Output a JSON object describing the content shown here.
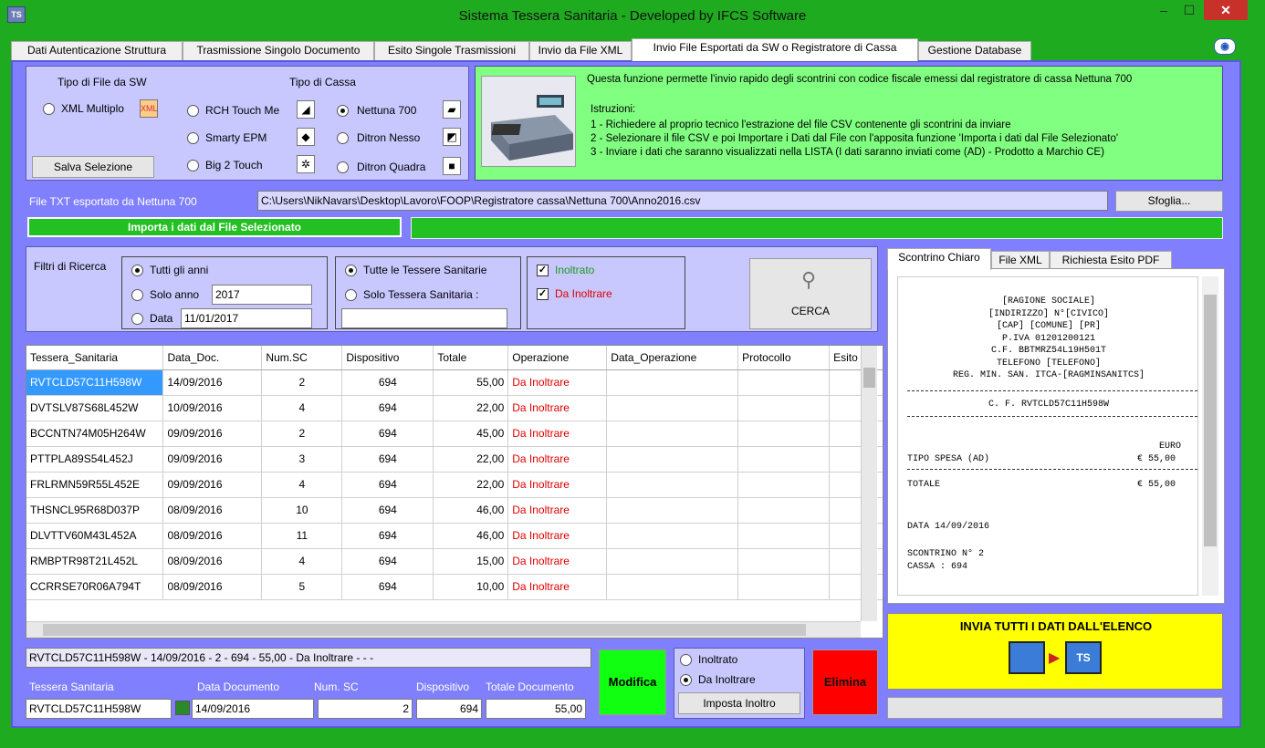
{
  "window": {
    "title": "Sistema Tessera Sanitaria - Developed by IFCS Software",
    "icon": "app-icon",
    "min": "–",
    "max": "☐",
    "close": "✕"
  },
  "tabs": [
    "Dati Autenticazione Struttura",
    "Trasmissione Singolo Documento",
    "Esito Singole Trasmissioni",
    "Invio da File XML",
    "Invio File Esportati da SW o Registratore di Cassa",
    "Gestione Database"
  ],
  "sw": {
    "title": "Tipo di File da SW",
    "xml": "XML Multiplo",
    "save": "Salva Selezione"
  },
  "cassa": {
    "title": "Tipo di Cassa",
    "opts": [
      "RCH Touch Me",
      "Smarty EPM",
      "Big 2 Touch",
      "Nettuna 700",
      "Ditron Nesso",
      "Ditron Quadra"
    ]
  },
  "info": {
    "line1": "Questa funzione permette l'invio rapido degli scontrini con codice fiscale emessi dal registratore di cassa Nettuna 700",
    "istr": "Istruzioni:",
    "s1": "1 - Richiedere al proprio tecnico l'estrazione del file CSV contenente gli scontrini da inviare",
    "s2": "2 - Selezionare il file CSV e poi Importare i Dati dal File con l'apposita funzione 'Importa i dati dal File Selezionato'",
    "s3": "3 - Inviare i dati che saranno visualizzati nella LISTA (I dati saranno inviati come (AD) - Prodotto a Marchio CE)"
  },
  "file": {
    "label": "File TXT esportato da Nettuna 700",
    "path": "C:\\Users\\NikNavars\\Desktop\\Lavoro\\FOOP\\Registratore cassa\\Nettuna 700\\Anno2016.csv",
    "browse": "Sfoglia...",
    "import": "Importa i dati dal File Selezionato"
  },
  "filters": {
    "title": "Filtri di Ricerca",
    "all": "Tutti gli anni",
    "year": "Solo anno",
    "year_val": "2017",
    "date": "Data",
    "date_val": "11/01/2017",
    "all_ts": "Tutte le Tessere Sanitarie",
    "one_ts": "Solo Tessera Sanitaria :",
    "sent": "Inoltrato",
    "tosend": "Da Inoltrare",
    "search": "CERCA"
  },
  "grid": {
    "headers": [
      "Tessera_Sanitaria",
      "Data_Doc.",
      "Num.SC",
      "Dispositivo",
      "Totale",
      "Operazione",
      "Data_Operazione",
      "Protocollo",
      "Esito"
    ],
    "rows": [
      [
        "RVTCLD57C11H598W",
        "14/09/2016",
        "2",
        "694",
        "55,00",
        "Da Inoltrare"
      ],
      [
        "DVTSLV87S68L452W",
        "10/09/2016",
        "4",
        "694",
        "22,00",
        "Da Inoltrare"
      ],
      [
        "BCCNTN74M05H264W",
        "09/09/2016",
        "2",
        "694",
        "45,00",
        "Da Inoltrare"
      ],
      [
        "PTTPLA89S54L452J",
        "09/09/2016",
        "3",
        "694",
        "22,00",
        "Da Inoltrare"
      ],
      [
        "FRLRMN59R55L452E",
        "09/09/2016",
        "4",
        "694",
        "22,00",
        "Da Inoltrare"
      ],
      [
        "THSNCL95R68D037P",
        "08/09/2016",
        "10",
        "694",
        "46,00",
        "Da Inoltrare"
      ],
      [
        "DLVTTV60M43L452A",
        "08/09/2016",
        "11",
        "694",
        "46,00",
        "Da Inoltrare"
      ],
      [
        "RMBPTR98T21L452L",
        "08/09/2016",
        "4",
        "694",
        "15,00",
        "Da Inoltrare"
      ],
      [
        "CCRRSE70R06A794T",
        "08/09/2016",
        "5",
        "694",
        "10,00",
        "Da Inoltrare"
      ]
    ]
  },
  "rtabs": [
    "Scontrino Chiaro",
    "File XML",
    "Richiesta Esito PDF"
  ],
  "receipt": [
    "[RAGIONE SOCIALE]",
    "[INDIRIZZO] N°[CIVICO]",
    "[CAP] [COMUNE] [PR]",
    "P.IVA 01201200121",
    "C.F. BBTMRZ54L19H501T",
    "TELEFONO [TELEFONO]",
    "REG. MIN. SAN. ITCA-[RAGMINSANITCS]",
    "C. F. RVTCLD57C11H598W",
    "EURO",
    "TIPO SPESA (AD)",
    "€  55,00",
    "TOTALE",
    "€  55,00",
    "DATA 14/09/2016",
    "SCONTRINO N° 2",
    "CASSA : 694"
  ],
  "send_all": "INVIA TUTTI I DATI DALL'ELENCO",
  "edit": {
    "summary": "RVTCLD57C11H598W - 14/09/2016 - 2 - 694 - 55,00 - Da Inoltrare - - -",
    "l_ts": "Tessera Sanitaria",
    "l_date": "Data Documento",
    "l_num": "Num. SC",
    "l_disp": "Dispositivo",
    "l_tot": "Totale Documento",
    "ts": "RVTCLD57C11H598W",
    "date": "14/09/2016",
    "num": "2",
    "disp": "694",
    "tot": "55,00",
    "modify": "Modifica",
    "sent": "Inoltrato",
    "tosend": "Da Inoltrare",
    "set": "Imposta Inoltro",
    "delete": "Elimina"
  },
  "colors": {
    "green": "#66ff66",
    "blue": "#8080ff",
    "yellow": "#ffff00",
    "red": "#ff0000"
  }
}
